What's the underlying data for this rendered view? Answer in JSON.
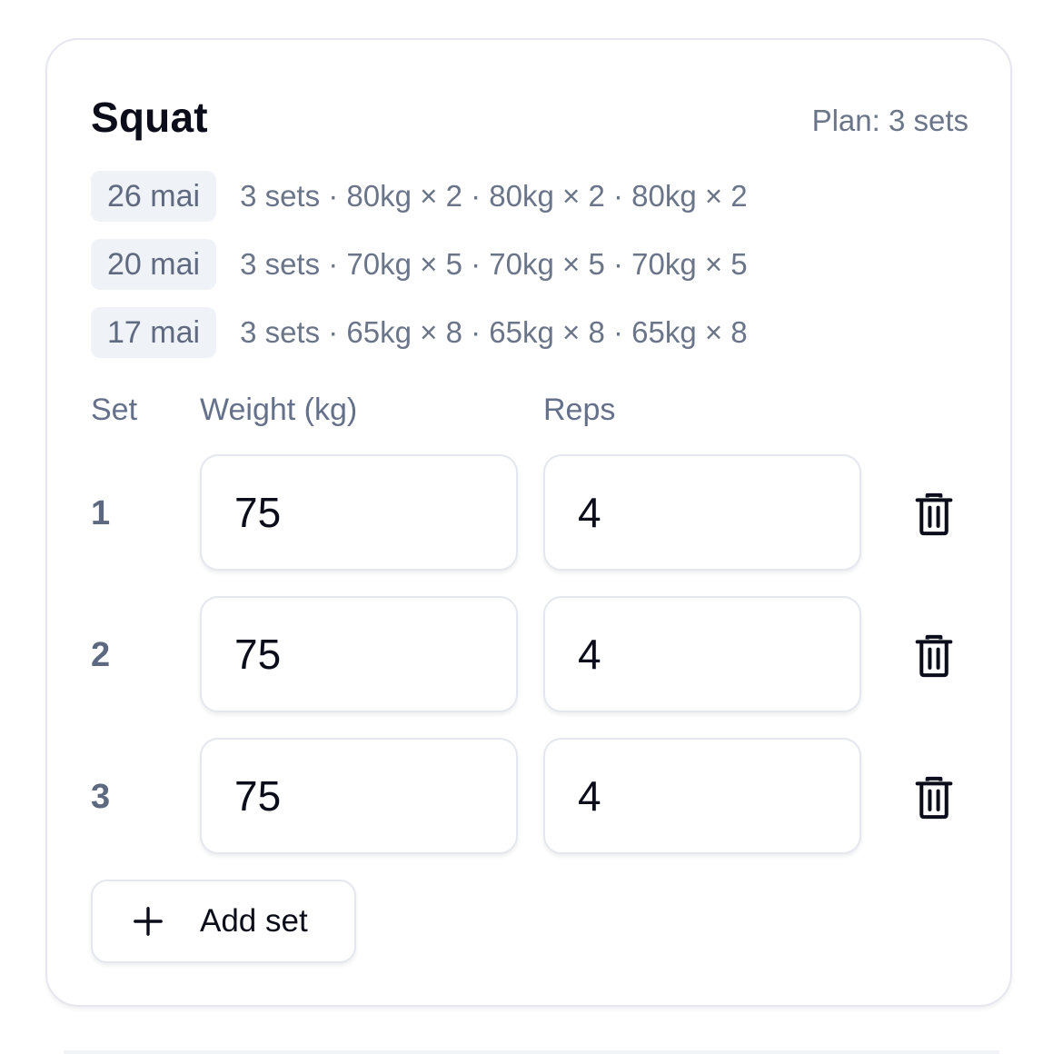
{
  "exercise": {
    "title": "Squat",
    "plan": "Plan: 3 sets"
  },
  "history": [
    {
      "date": "26 mai",
      "summary": "3 sets · 80kg × 2 · 80kg × 2 · 80kg × 2"
    },
    {
      "date": "20 mai",
      "summary": "3 sets · 70kg × 5 · 70kg × 5 · 70kg × 5"
    },
    {
      "date": "17 mai",
      "summary": "3 sets · 65kg × 8 · 65kg × 8 · 65kg × 8"
    }
  ],
  "columns": {
    "set": "Set",
    "weight": "Weight (kg)",
    "reps": "Reps"
  },
  "sets": [
    {
      "number": "1",
      "weight": "75",
      "reps": "4"
    },
    {
      "number": "2",
      "weight": "75",
      "reps": "4"
    },
    {
      "number": "3",
      "weight": "75",
      "reps": "4"
    }
  ],
  "add_button": {
    "label": "Add set",
    "icon": "plus-icon"
  },
  "row_action_icon": "trash-icon",
  "colors": {
    "text_primary": "#0b0d1a",
    "text_muted": "#6b7589",
    "chip_bg": "#eff2f7",
    "border": "#e5e7ee"
  }
}
